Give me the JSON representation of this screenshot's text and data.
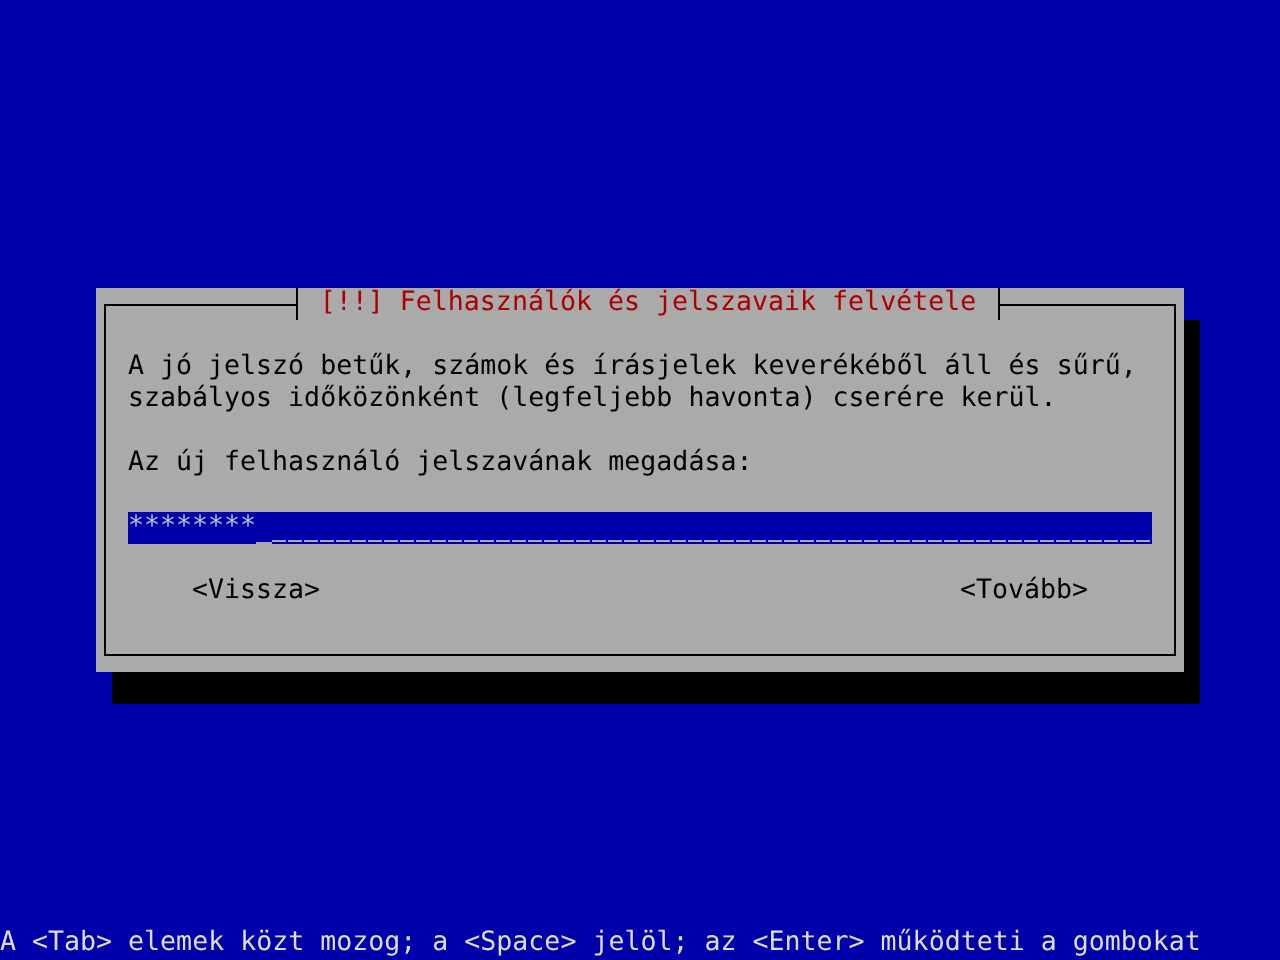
{
  "dialog": {
    "title": "[!!] Felhasználók és jelszavaik felvétele",
    "message": [
      "A jó jelszó betűk, számok és írásjelek keverékéből áll és sűrű,",
      "szabályos időközönként (legfeljebb havonta) cserére kerül."
    ],
    "prompt": "Az új felhasználó jelszavának megadása:",
    "password_field": {
      "value": "********"
    },
    "buttons": [
      {
        "label": "<Vissza>"
      },
      {
        "label": "<Tovább>"
      }
    ]
  },
  "help_line": "A <Tab> elemek közt mozog; a <Space> jelöl; az <Enter> működteti a gombokat"
}
